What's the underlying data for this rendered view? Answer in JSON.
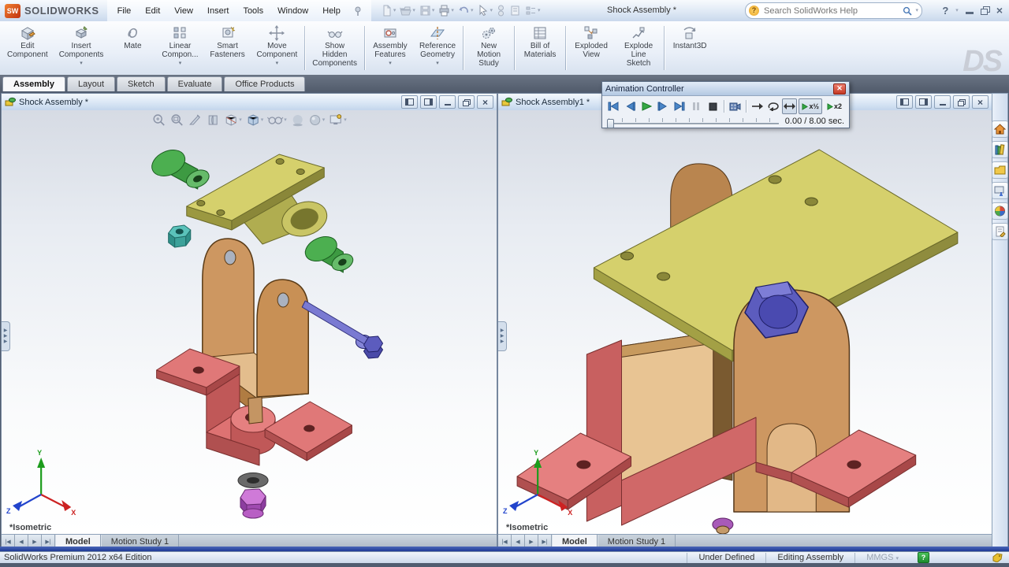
{
  "app": {
    "logo_text": "SOLIDWORKS",
    "window_title": "Shock Assembly *",
    "menus": [
      "File",
      "Edit",
      "View",
      "Insert",
      "Tools",
      "Window",
      "Help"
    ],
    "search": {
      "placeholder": "Search SolidWorks Help"
    },
    "ds_watermark": "DS"
  },
  "ribbon": {
    "tabs": [
      "Assembly",
      "Layout",
      "Sketch",
      "Evaluate",
      "Office Products"
    ],
    "active_tab": "Assembly",
    "buttons": [
      {
        "label": "Edit\nComponent",
        "dropdown": false
      },
      {
        "label": "Insert\nComponents",
        "dropdown": true
      },
      {
        "label": "Mate",
        "dropdown": false
      },
      {
        "label": "Linear\nCompon...",
        "dropdown": true
      },
      {
        "label": "Smart\nFasteners",
        "dropdown": false
      },
      {
        "label": "Move\nComponent",
        "dropdown": true
      },
      {
        "label": "Show\nHidden\nComponents",
        "dropdown": false
      },
      {
        "label": "Assembly\nFeatures",
        "dropdown": true
      },
      {
        "label": "Reference\nGeometry",
        "dropdown": true
      },
      {
        "label": "New\nMotion\nStudy",
        "dropdown": false
      },
      {
        "label": "Bill of\nMaterials",
        "dropdown": false
      },
      {
        "label": "Exploded\nView",
        "dropdown": false
      },
      {
        "label": "Explode\nLine\nSketch",
        "dropdown": false
      },
      {
        "label": "Instant3D",
        "dropdown": false
      }
    ]
  },
  "animation_controller": {
    "title": "Animation Controller",
    "time_label": "0.00 / 8.00 sec.",
    "speed_half": "x½",
    "speed_double": "x2"
  },
  "windows": {
    "left": {
      "title": "Shock Assembly *",
      "view_orientation": "*Isometric",
      "model_tab": "Model",
      "motion_tab": "Motion Study 1"
    },
    "right": {
      "title": "Shock Assembly1 *",
      "view_orientation": "*Isometric",
      "model_tab": "Model",
      "motion_tab": "Motion Study 1"
    }
  },
  "triad": {
    "x": "X",
    "y": "Y",
    "z": "Z"
  },
  "status_bar": {
    "edition": "SolidWorks Premium 2012 x64 Edition",
    "constraint_status": "Under Defined",
    "mode": "Editing Assembly",
    "units": "MMGS"
  },
  "part_colors": {
    "bushing_green": "#4caf50",
    "plate_yellow": "#d5d06c",
    "nut_teal": "#45b0a8",
    "clevis_tan": "#cd9761",
    "bolt_blue": "#6666c4",
    "bracket_red": "#e07878",
    "lock_nut_magenta": "#cf7ad8",
    "washer_gray": "#6a6a6a"
  }
}
